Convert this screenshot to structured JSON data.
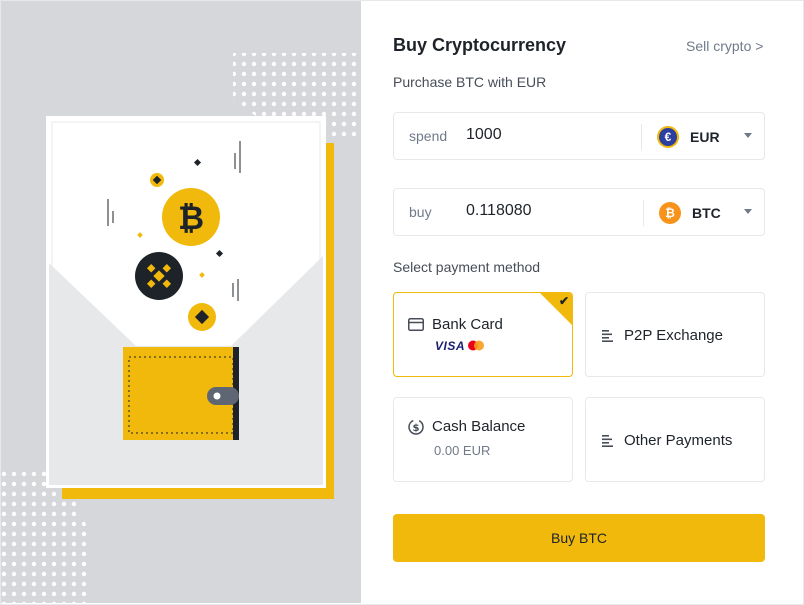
{
  "header": {
    "title": "Buy Cryptocurrency",
    "sell_link": "Sell crypto >",
    "subtitle": "Purchase BTC with EUR"
  },
  "spend": {
    "label": "spend",
    "value": "1000",
    "currency_code": "EUR",
    "currency_icon": "euro-coin-icon",
    "currency_glyph": "€",
    "currency_color": "#2c3e9e"
  },
  "buy": {
    "label": "buy",
    "value": "0.118080",
    "currency_code": "BTC",
    "currency_icon": "bitcoin-coin-icon",
    "currency_glyph": "₿",
    "currency_color": "#f7931a"
  },
  "payment": {
    "section_label": "Select payment method",
    "methods": [
      {
        "label": "Bank Card",
        "icon": "card-icon",
        "selected": true,
        "brand_text": "VISA"
      },
      {
        "label": "P2P Exchange",
        "icon": "list-icon",
        "selected": false
      },
      {
        "label": "Cash Balance",
        "sublabel": "0.00 EUR",
        "icon": "dollar-coin-icon",
        "selected": false
      },
      {
        "label": "Other Payments",
        "icon": "list-icon",
        "selected": false
      }
    ]
  },
  "action": {
    "buy_label": "Buy BTC"
  },
  "colors": {
    "accent": "#f0b90b",
    "panel_bg": "#d5d7da",
    "text_primary": "#1e2329",
    "text_secondary": "#707a8a"
  },
  "illustration": {
    "icons": [
      "wallet-icon",
      "bitcoin-icon",
      "binance-icon",
      "dotted-pattern"
    ]
  }
}
